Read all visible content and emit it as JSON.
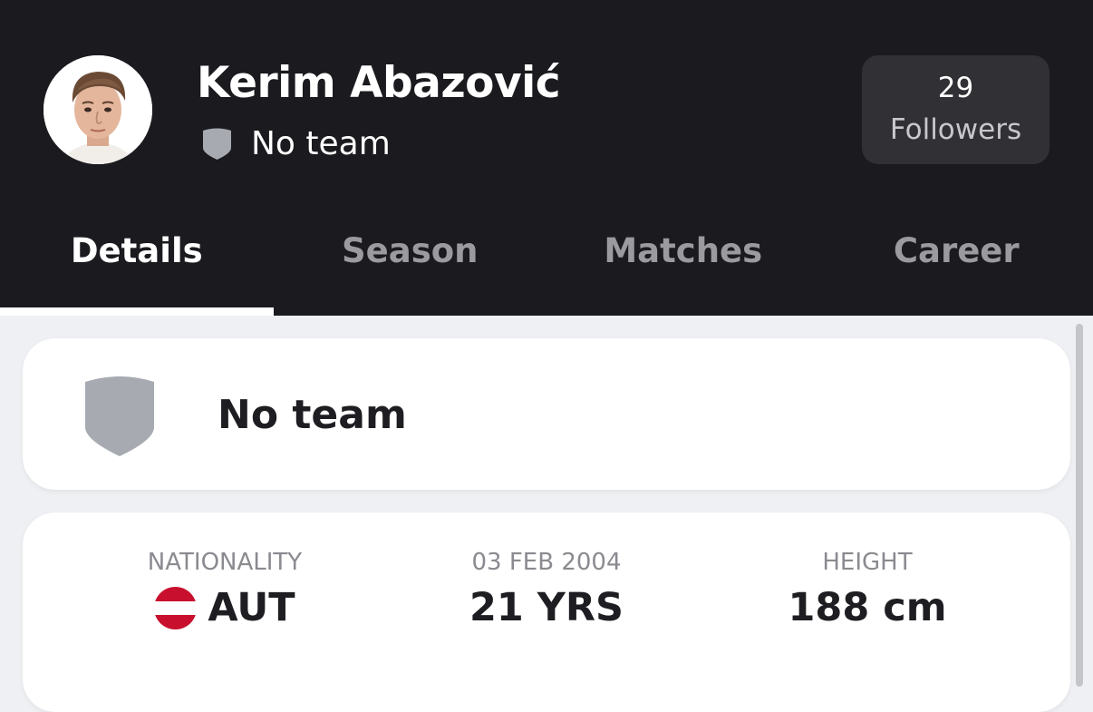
{
  "player": {
    "name": "Kerim Abazović",
    "team": "No team"
  },
  "followers": {
    "count": "29",
    "label": "Followers"
  },
  "tabs": [
    {
      "label": "Details",
      "active": true
    },
    {
      "label": "Season",
      "active": false
    },
    {
      "label": "Matches",
      "active": false
    },
    {
      "label": "Career",
      "active": false
    }
  ],
  "team_card": {
    "name": "No team",
    "icon": "shield-icon"
  },
  "info": {
    "nationality_caption": "NATIONALITY",
    "nationality_value": "AUT",
    "nationality_flag": "austria-flag-icon",
    "birthdate_caption": "03 FEB 2004",
    "age_value": "21 YRS",
    "height_caption": "HEIGHT",
    "height_value": "188 cm"
  },
  "colors": {
    "header_bg": "#1b1a1f",
    "page_bg": "#eff0f3",
    "shield_gray": "#a7aab1",
    "flag_red": "#c8102e"
  }
}
